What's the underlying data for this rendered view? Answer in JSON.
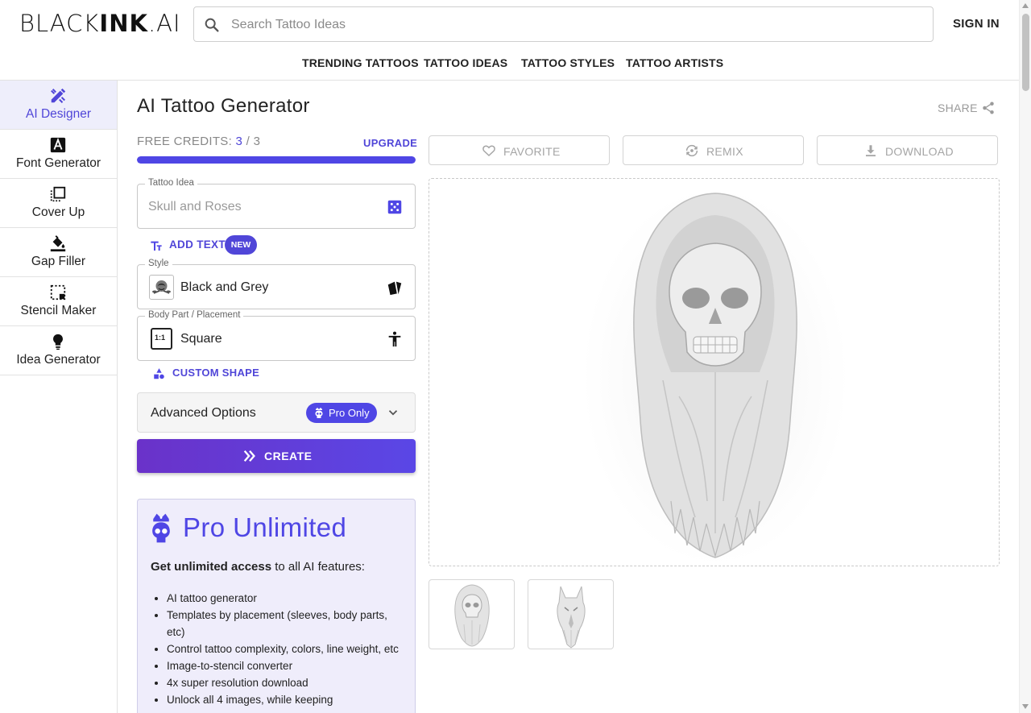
{
  "brand": {
    "logo_light": "BLACK",
    "logo_bold": "INK",
    "logo_suffix": ".AI"
  },
  "search": {
    "placeholder": "Search Tattoo Ideas",
    "icon": "search-icon"
  },
  "header": {
    "signin_label": "SIGN IN"
  },
  "nav": {
    "items": [
      "TRENDING TATTOOS",
      "TATTOO IDEAS",
      "TATTOO STYLES",
      "TATTOO ARTISTS"
    ]
  },
  "sidebar": {
    "items": [
      {
        "label": "AI Designer",
        "icon": "pencil-ruler-icon",
        "active": true
      },
      {
        "label": "Font Generator",
        "icon": "font-icon",
        "active": false
      },
      {
        "label": "Cover Up",
        "icon": "layers-icon",
        "active": false
      },
      {
        "label": "Gap Filler",
        "icon": "paint-bucket-icon",
        "active": false
      },
      {
        "label": "Stencil Maker",
        "icon": "selection-icon",
        "active": false
      },
      {
        "label": "Idea Generator",
        "icon": "lightbulb-icon",
        "active": false
      }
    ]
  },
  "main": {
    "title": "AI Tattoo Generator",
    "share_label": "SHARE",
    "credits": {
      "label": "FREE CREDITS:",
      "used": "3",
      "separator": "/",
      "total": "3",
      "fill_fraction": 1.0
    },
    "upgrade_label": "UPGRADE",
    "idea_field": {
      "label": "Tattoo Idea",
      "placeholder": "Skull and Roses",
      "icon": "dice-icon"
    },
    "add_text": {
      "label": "ADD TEXT",
      "badge": "NEW",
      "icon": "text-size-icon"
    },
    "style_field": {
      "label": "Style",
      "value": "Black and Grey",
      "icon": "cards-icon"
    },
    "placement_field": {
      "label": "Body Part / Placement",
      "value": "Square",
      "thumb_text": "1:1",
      "icon": "person-icon"
    },
    "custom_shape": {
      "label": "CUSTOM SHAPE",
      "icon": "shapes-icon"
    },
    "advanced": {
      "label": "Advanced Options",
      "badge": "Pro Only",
      "icon": "chevron-down-icon"
    },
    "create_label": "CREATE",
    "pro": {
      "title": "Pro Unlimited",
      "intro_bold": "Get unlimited access",
      "intro_rest": " to all AI features:",
      "features": [
        "AI tattoo generator",
        "Templates by placement (sleeves, body parts, etc)",
        "Control tattoo complexity, colors, line weight, etc",
        "Image-to-stencil converter",
        "4x super resolution download",
        "Unlock all 4 images, while keeping"
      ]
    }
  },
  "actions": {
    "favorite": "FAVORITE",
    "remix": "REMIX",
    "download": "DOWNLOAD"
  },
  "colors": {
    "accent": "#4f46e5",
    "accent_text": "#5046d8",
    "active_bg": "#eeeefb",
    "pro_bg": "#efedfb"
  }
}
